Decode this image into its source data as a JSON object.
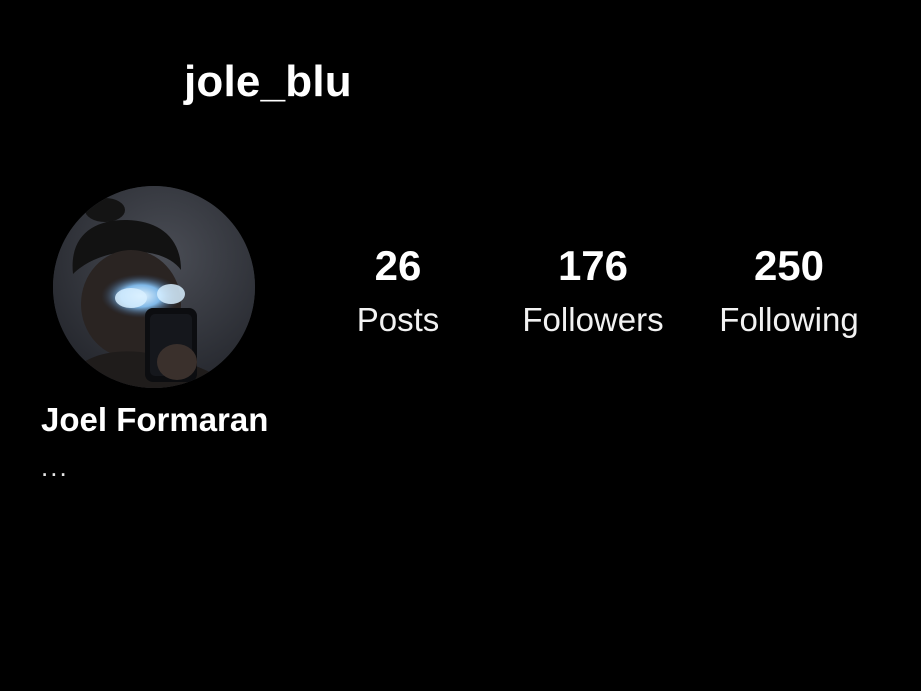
{
  "profile": {
    "username": "jole_blu",
    "display_name": "Joel Formaran",
    "bio": "...",
    "avatar_icon": "profile-photo"
  },
  "stats": [
    {
      "count": "26",
      "label": "Posts"
    },
    {
      "count": "176",
      "label": "Followers"
    },
    {
      "count": "250",
      "label": "Following"
    }
  ]
}
